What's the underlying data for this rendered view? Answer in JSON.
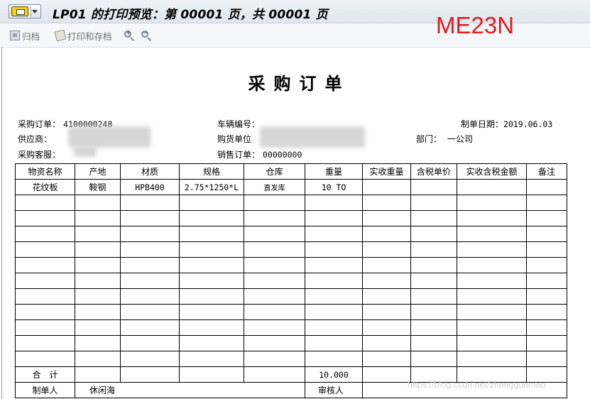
{
  "window": {
    "title": "LP01 的打印预览：第 00001 页，共 00001  页"
  },
  "toolbar": {
    "archive_label": "归档",
    "print_archive_label": "打印和存档"
  },
  "annotation": "ME23N",
  "document": {
    "title": "采购订单",
    "fields": {
      "po_label": "采购订单：",
      "po_value": "4100000248",
      "vehicle_label": "车辆编号：",
      "created_label": "制单日期：",
      "created_value": "2019.06.03",
      "supplier_label": "供应商：",
      "buyer_unit_label": "购货单位",
      "dept_label": "部门：",
      "dept_value": "一公司",
      "service_label": "采购客服：",
      "sales_order_label": "销售订单：",
      "sales_order_value": "00000000"
    },
    "table": {
      "headers": [
        "物资名称",
        "产地",
        "材质",
        "规格",
        "仓库",
        "重量",
        "实收重量",
        "含税单价",
        "实收含税金额",
        "备注"
      ],
      "rows": [
        [
          "花纹板",
          "鞍钢",
          "HPB400",
          "2.75*1250*L",
          "直发库",
          "10  TO",
          "",
          "",
          "",
          ""
        ]
      ],
      "total_label": "合　计",
      "total_weight": "10.000",
      "maker_label": "制单人",
      "maker_value": "休闲海",
      "reviewer_label": "审核人"
    }
  },
  "watermark": "https://blog.csdn.net/zhongguomao"
}
